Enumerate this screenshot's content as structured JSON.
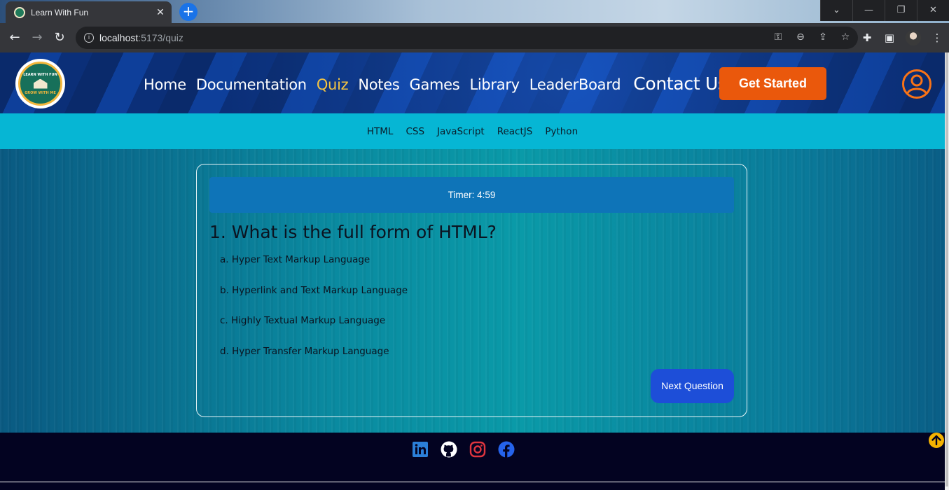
{
  "browser": {
    "tab_title": "Learn With Fun",
    "tab_close": "✕",
    "new_tab": "+",
    "url_host": "localhost",
    "url_path": ":5173/quiz",
    "window_controls": [
      "⌄",
      "—",
      "❐",
      "✕"
    ]
  },
  "site": {
    "logo": {
      "top_text": "LEARN WITH FUN",
      "bottom_text": "GROW WITH ME"
    },
    "nav": [
      {
        "label": "Home"
      },
      {
        "label": "Documentation"
      },
      {
        "label": "Quiz",
        "active": true
      },
      {
        "label": "Notes"
      },
      {
        "label": "Games"
      },
      {
        "label": "Library"
      },
      {
        "label": "LeaderBoard"
      },
      {
        "label": "Contact Us"
      }
    ],
    "cta_label": "Get Started",
    "colors": {
      "accent": "#ea580c",
      "active_nav": "#f5c542",
      "subnav_bg": "#06b6d4",
      "primary_button": "#1d4ed8",
      "footer_bg": "#030321"
    }
  },
  "subnav": [
    "HTML",
    "CSS",
    "JavaScript",
    "ReactJS",
    "Python"
  ],
  "quiz": {
    "timer_text": "Timer: 4:59",
    "question": "1. What is the full form of HTML?",
    "options": [
      "a. Hyper Text Markup Language",
      "b. Hyperlink and Text Markup Language",
      "c. Highly Textual Markup Language",
      "d. Hyper Transfer Markup Language"
    ],
    "next_label": "Next Question"
  },
  "footer": {
    "socials": [
      "linkedin-icon",
      "github-icon",
      "instagram-icon",
      "facebook-icon"
    ]
  }
}
